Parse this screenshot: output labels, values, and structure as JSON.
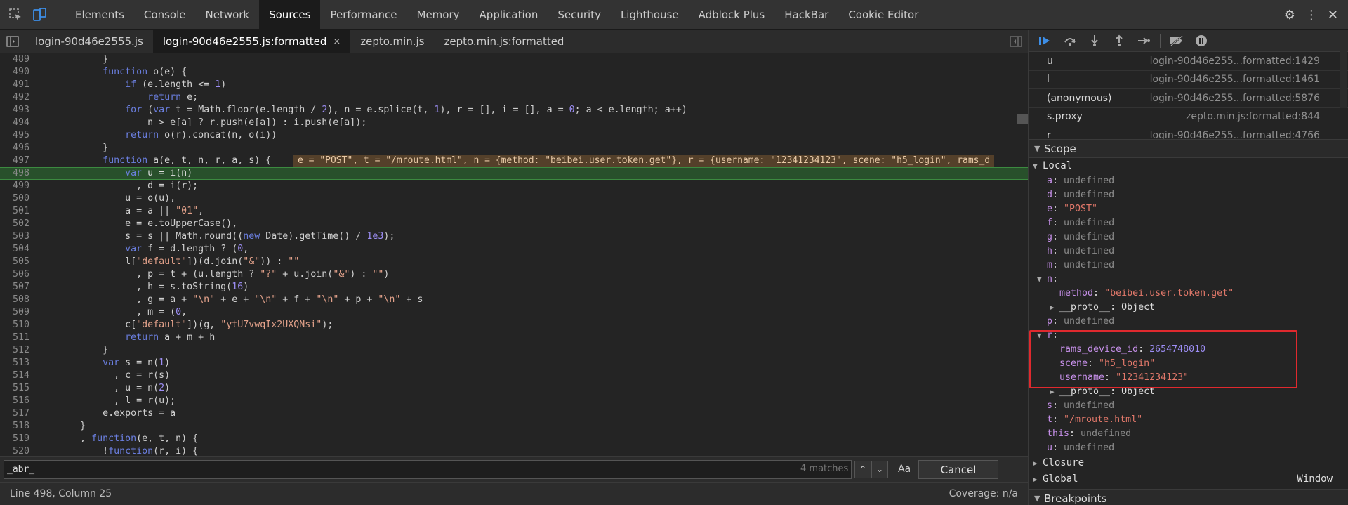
{
  "main_tabs": [
    "Elements",
    "Console",
    "Network",
    "Sources",
    "Performance",
    "Memory",
    "Application",
    "Security",
    "Lighthouse",
    "Adblock Plus",
    "HackBar",
    "Cookie Editor"
  ],
  "active_main_tab": "Sources",
  "file_tabs": [
    {
      "label": "login-90d46e2555.js",
      "active": false
    },
    {
      "label": "login-90d46e2555.js:formatted",
      "active": true,
      "closable": true
    },
    {
      "label": "zepto.min.js",
      "active": false
    },
    {
      "label": "zepto.min.js:formatted",
      "active": false
    }
  ],
  "close_glyph": "×",
  "code_lines": [
    {
      "n": "489",
      "h": "            }"
    },
    {
      "n": "490",
      "h": "            <span class=\"k\">function</span> o(e) {"
    },
    {
      "n": "491",
      "h": "                <span class=\"k\">if</span> (e.length <= <span class=\"n\">1</span>)"
    },
    {
      "n": "492",
      "h": "                    <span class=\"k\">return</span> e;"
    },
    {
      "n": "493",
      "h": "                <span class=\"k\">for</span> (<span class=\"k\">var</span> t = Math.floor(e.length / <span class=\"n\">2</span>), n = e.splice(t, <span class=\"n\">1</span>), r = [], i = [], a = <span class=\"n\">0</span>; a < e.length; a++)"
    },
    {
      "n": "494",
      "h": "                    n > e[a] ? r.push(e[a]) : i.push(e[a]);"
    },
    {
      "n": "495",
      "h": "                <span class=\"k\">return</span> o(r).concat(n, o(i))"
    },
    {
      "n": "496",
      "h": "            }"
    },
    {
      "n": "497",
      "h": "            <span class=\"k\">function</span> a(e, t, n, r, a, s) {",
      "inline": "e = \"POST\", t = \"/mroute.html\", n = {method: \"beibei.user.token.get\"}, r = {username: \"12341234123\", scene: \"h5_login\", rams_d"
    },
    {
      "n": "498",
      "h": "                <span class=\"k\">var</span> u = i(n)",
      "hl": true
    },
    {
      "n": "499",
      "h": "                  , d = i(r);"
    },
    {
      "n": "500",
      "h": "                u = o(u),"
    },
    {
      "n": "501",
      "h": "                a = a || <span class=\"s\">\"01\"</span>,"
    },
    {
      "n": "502",
      "h": "                e = e.toUpperCase(),"
    },
    {
      "n": "503",
      "h": "                s = s || Math.round((<span class=\"k\">new</span> Date).getTime() / <span class=\"n\">1e3</span>);"
    },
    {
      "n": "504",
      "h": "                <span class=\"k\">var</span> f = d.length ? (<span class=\"n\">0</span>,"
    },
    {
      "n": "505",
      "h": "                l[<span class=\"s\">\"default\"</span>])(d.join(<span class=\"s\">\"&\"</span>)) : <span class=\"s\">\"\"</span>"
    },
    {
      "n": "506",
      "h": "                  , p = t + (u.length ? <span class=\"s\">\"?\"</span> + u.join(<span class=\"s\">\"&\"</span>) : <span class=\"s\">\"\"</span>)"
    },
    {
      "n": "507",
      "h": "                  , h = s.toString(<span class=\"n\">16</span>)"
    },
    {
      "n": "508",
      "h": "                  , g = a + <span class=\"s\">\"\\n\"</span> + e + <span class=\"s\">\"\\n\"</span> + f + <span class=\"s\">\"\\n\"</span> + p + <span class=\"s\">\"\\n\"</span> + s"
    },
    {
      "n": "509",
      "h": "                  , m = (<span class=\"n\">0</span>,"
    },
    {
      "n": "510",
      "h": "                c[<span class=\"s\">\"default\"</span>])(g, <span class=\"s\">\"ytU7vwqIx2UXQNsi\"</span>);"
    },
    {
      "n": "511",
      "h": "                <span class=\"k\">return</span> a + m + h"
    },
    {
      "n": "512",
      "h": "            }"
    },
    {
      "n": "513",
      "h": "            <span class=\"k\">var</span> s = n(<span class=\"n\">1</span>)"
    },
    {
      "n": "514",
      "h": "              , c = r(s)"
    },
    {
      "n": "515",
      "h": "              , u = n(<span class=\"n\">2</span>)"
    },
    {
      "n": "516",
      "h": "              , l = r(u);"
    },
    {
      "n": "517",
      "h": "            e.exports = a"
    },
    {
      "n": "518",
      "h": "        }"
    },
    {
      "n": "519",
      "h": "        , <span class=\"k\">function</span>(e, t, n) {"
    },
    {
      "n": "520",
      "h": "            !<span class=\"k\">function</span>(r, i) {"
    }
  ],
  "search": {
    "value": "_abr_",
    "matches": "4 matches",
    "case_label": "Aa",
    "regex_label": ".*",
    "cancel_label": "Cancel",
    "prev": "⌃",
    "next": "⌄"
  },
  "status": {
    "position": "Line 498, Column 25",
    "coverage": "Coverage: n/a"
  },
  "call_stack": [
    {
      "fn": "u",
      "loc": "login-90d46e255...formatted:1429"
    },
    {
      "fn": "l",
      "loc": "login-90d46e255...formatted:1461"
    },
    {
      "fn": "(anonymous)",
      "loc": "login-90d46e255...formatted:5876"
    },
    {
      "fn": "s.proxy",
      "loc": "zepto.min.js:formatted:844"
    },
    {
      "fn": "r",
      "loc": "login-90d46e255...formatted:4766"
    }
  ],
  "scope_title": "Scope",
  "local_title": "Local",
  "scope_rows": [
    {
      "i": 1,
      "k": "a",
      "v": "undefined",
      "t": "und"
    },
    {
      "i": 1,
      "k": "d",
      "v": "undefined",
      "t": "und"
    },
    {
      "i": 1,
      "k": "e",
      "v": "\"POST\"",
      "t": "str"
    },
    {
      "i": 1,
      "k": "f",
      "v": "undefined",
      "t": "und"
    },
    {
      "i": 1,
      "k": "g",
      "v": "undefined",
      "t": "und"
    },
    {
      "i": 1,
      "k": "h",
      "v": "undefined",
      "t": "und"
    },
    {
      "i": 1,
      "k": "m",
      "v": "undefined",
      "t": "und"
    },
    {
      "i": 1,
      "k": "n",
      "v": "",
      "t": "plain",
      "tri": "▼"
    },
    {
      "i": 2,
      "k": "method",
      "v": "\"beibei.user.token.get\"",
      "t": "str"
    },
    {
      "i": 2,
      "k": "__proto__",
      "v": "Object",
      "t": "plain",
      "tri": "▶"
    },
    {
      "i": 1,
      "k": "p",
      "v": "undefined",
      "t": "und"
    },
    {
      "i": 1,
      "k": "r",
      "v": "",
      "t": "plain",
      "tri": "▼"
    },
    {
      "i": 2,
      "k": "rams_device_id",
      "v": "2654748010",
      "t": "num"
    },
    {
      "i": 2,
      "k": "scene",
      "v": "\"h5_login\"",
      "t": "str"
    },
    {
      "i": 2,
      "k": "username",
      "v": "\"12341234123\"",
      "t": "str"
    },
    {
      "i": 2,
      "k": "__proto__",
      "v": "Object",
      "t": "plain",
      "tri": "▶"
    },
    {
      "i": 1,
      "k": "s",
      "v": "undefined",
      "t": "und"
    },
    {
      "i": 1,
      "k": "t",
      "v": "\"/mroute.html\"",
      "t": "str"
    },
    {
      "i": 1,
      "k": "this",
      "v": "undefined",
      "t": "und"
    },
    {
      "i": 1,
      "k": "u",
      "v": "undefined",
      "t": "und"
    }
  ],
  "closure_title": "Closure",
  "global_title": "Global",
  "global_value": "Window",
  "breakpoints_title": "Breakpoints",
  "colors": {
    "highlight_line": "#28502b",
    "annotation_box": "#e0292e",
    "active_icon": "#3d8ee6"
  }
}
